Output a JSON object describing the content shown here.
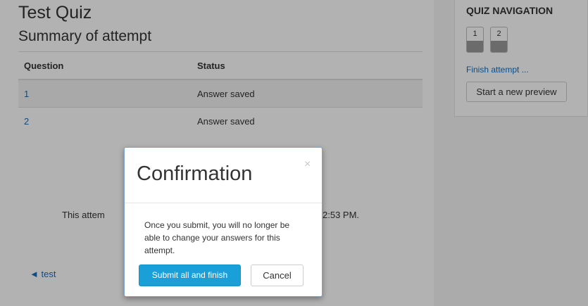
{
  "quiz": {
    "title": "Test Quiz",
    "subtitle": "Summary of attempt",
    "table": {
      "headers": [
        "Question",
        "Status"
      ],
      "rows": [
        {
          "question": "1",
          "status": "Answer saved"
        },
        {
          "question": "2",
          "status": "Answer saved"
        }
      ]
    },
    "attempt_text_left": "This attem",
    "attempt_text_right": "2:53 PM.",
    "back_link": "◄ test"
  },
  "navigation": {
    "title": "QUIZ NAVIGATION",
    "question_buttons": [
      "1",
      "2"
    ],
    "finish_link": "Finish attempt ...",
    "new_preview": "Start a new preview"
  },
  "modal": {
    "title": "Confirmation",
    "close_icon": "×",
    "body": "Once you submit, you will no longer be able to change your answers for this attempt.",
    "submit_label": "Submit all and finish",
    "cancel_label": "Cancel"
  },
  "colors": {
    "link": "#0f6fc5",
    "primary_button": "#1aa0d8",
    "overlay": "rgba(0,0,0,0.3)"
  }
}
